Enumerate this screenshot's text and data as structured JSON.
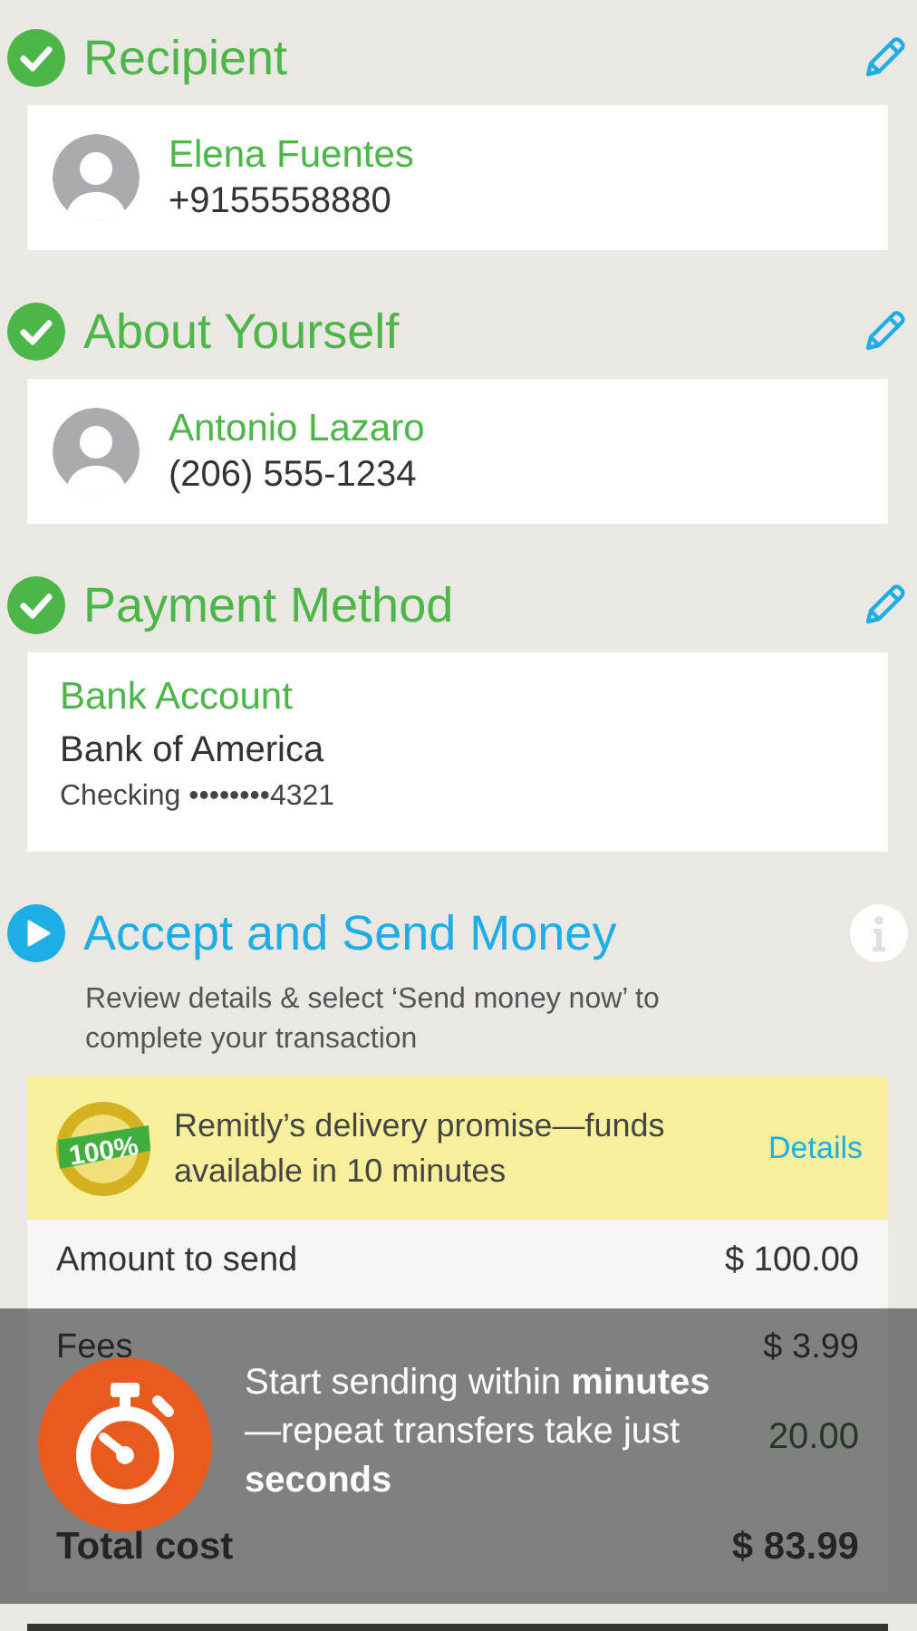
{
  "sections": [
    {
      "kind": "contact",
      "completed": true,
      "title": "Recipient",
      "editable": true,
      "name": "Elena Fuentes",
      "detail": "+9155558880"
    },
    {
      "kind": "contact",
      "completed": true,
      "title": "About Yourself",
      "editable": true,
      "name": "Antonio Lazaro",
      "detail": "(206) 555-1234"
    },
    {
      "kind": "payment",
      "completed": true,
      "title": "Payment Method",
      "editable": true,
      "method": "Bank Account",
      "bank": "Bank of America",
      "account": "Checking ••••••••4321"
    },
    {
      "kind": "review",
      "completed": false,
      "title": "Accept and Send Money",
      "info": true,
      "description": "Review details & select ‘Send money now’ to complete your transaction",
      "promise": {
        "badge": "100%",
        "text": "Remitly’s delivery promise—funds available in 10 minutes",
        "link": "Details"
      },
      "summary": [
        {
          "kind": "plain",
          "label": "Amount to send",
          "value": "$ 100.00"
        },
        {
          "kind": "plain",
          "label": "Fees",
          "value": "$ 3.99"
        },
        {
          "kind": "discount",
          "value": "20.00"
        },
        {
          "kind": "total",
          "label": "Total cost",
          "value": "$ 83.99"
        }
      ]
    }
  ],
  "tip": {
    "text": "Start sending within **minutes**—repeat transfers take just **seconds**"
  }
}
